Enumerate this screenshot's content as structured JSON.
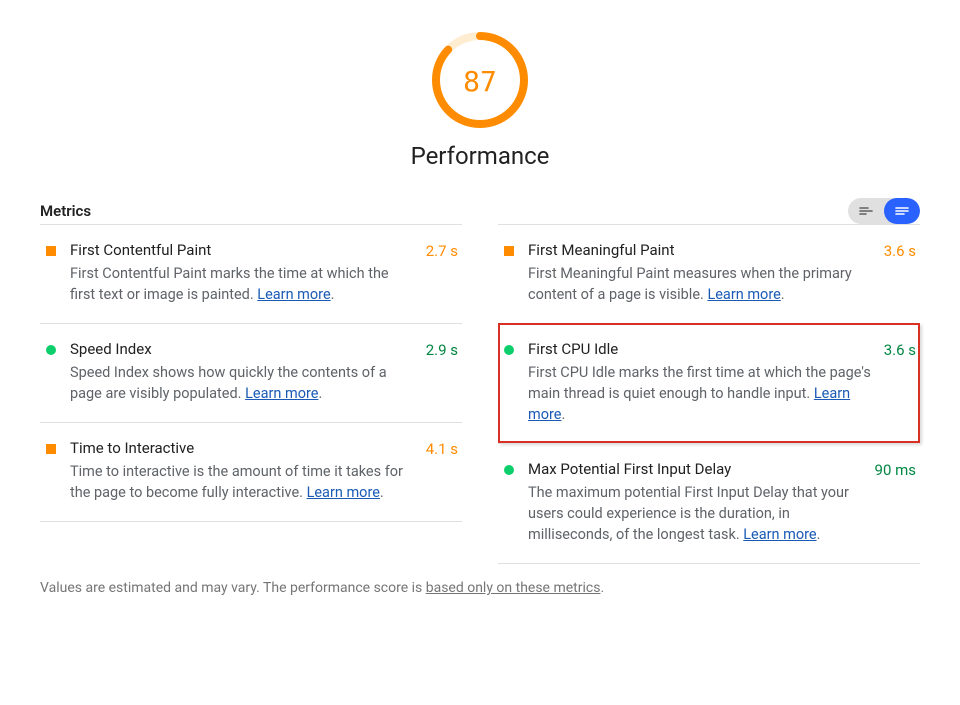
{
  "gauge": {
    "score": "87",
    "label": "Performance"
  },
  "metrics_header": "Metrics",
  "metrics": {
    "fcp": {
      "title": "First Contentful Paint",
      "desc": "First Contentful Paint marks the time at which the first text or image is painted. ",
      "learn": "Learn more",
      "value": "2.7 s"
    },
    "fmp": {
      "title": "First Meaningful Paint",
      "desc": "First Meaningful Paint measures when the primary content of a page is visible. ",
      "learn": "Learn more",
      "value": "3.6 s"
    },
    "si": {
      "title": "Speed Index",
      "desc": "Speed Index shows how quickly the contents of a page are visibly populated. ",
      "learn": "Learn more",
      "value": "2.9 s"
    },
    "fci": {
      "title": "First CPU Idle",
      "desc": "First CPU Idle marks the first time at which the page's main thread is quiet enough to handle input. ",
      "learn": "Learn more",
      "value": "3.6 s"
    },
    "tti": {
      "title": "Time to Interactive",
      "desc": "Time to interactive is the amount of time it takes for the page to become fully interactive. ",
      "learn": "Learn more",
      "value": "4.1 s"
    },
    "mfid": {
      "title": "Max Potential First Input Delay",
      "desc": "The maximum potential First Input Delay that your users could experience is the duration, in milliseconds, of the longest task. ",
      "learn": "Learn more",
      "value": "90 ms"
    }
  },
  "footer": {
    "prefix": "Values are estimated and may vary. The performance score is ",
    "link": "based only on these metrics",
    "suffix": "."
  }
}
